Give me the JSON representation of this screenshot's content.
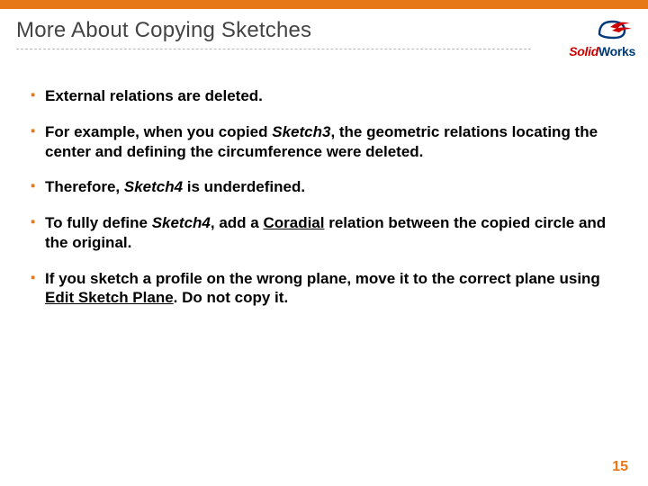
{
  "header": {
    "title": "More About Copying Sketches",
    "logo": {
      "solid": "Solid",
      "works": "Works"
    }
  },
  "bullets": [
    {
      "pre": "External relations are deleted."
    },
    {
      "pre": "For example, when you copied ",
      "ital1": "Sketch3",
      "mid": ", the geometric relations locating the center and defining the circumference were deleted."
    },
    {
      "pre": "Therefore, ",
      "ital1": "Sketch4",
      "mid": " is underdefined."
    },
    {
      "pre": "To fully define ",
      "ital1": "Sketch4",
      "mid": ", add a ",
      "ul1": "Coradial",
      "post": " relation between the copied circle and the original."
    },
    {
      "pre": "If you sketch a profile on the wrong plane, move it to the correct plane using ",
      "ul1": "Edit Sketch Plane",
      "post": ". Do not copy it."
    }
  ],
  "pageNumber": "15"
}
